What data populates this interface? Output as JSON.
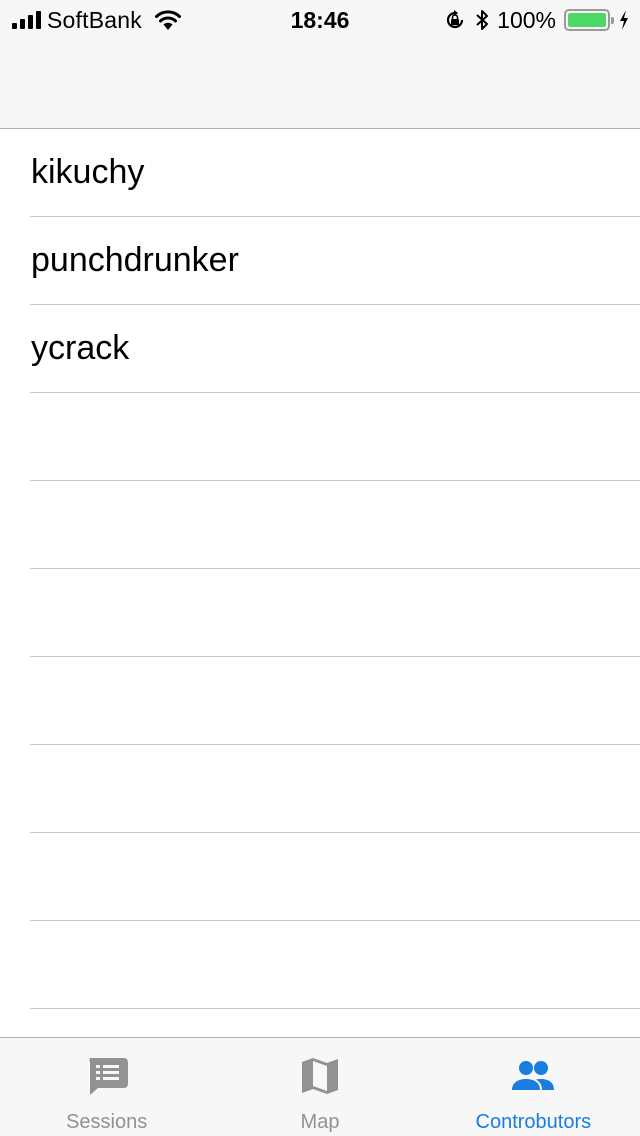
{
  "status_bar": {
    "carrier": "SoftBank",
    "time": "18:46",
    "battery": "100%"
  },
  "nav_bar": {
    "title": ""
  },
  "contributors": [
    "kikuchy",
    "punchdrunker",
    "ycrack"
  ],
  "tabs": [
    {
      "label": "Sessions",
      "icon": "sessions-icon",
      "active": false
    },
    {
      "label": "Map",
      "icon": "map-icon",
      "active": false
    },
    {
      "label": "Controbutors",
      "icon": "people-icon",
      "active": true
    }
  ],
  "colors": {
    "accent": "#1a7de0",
    "inactive": "#929292",
    "battery": "#4cd964"
  }
}
